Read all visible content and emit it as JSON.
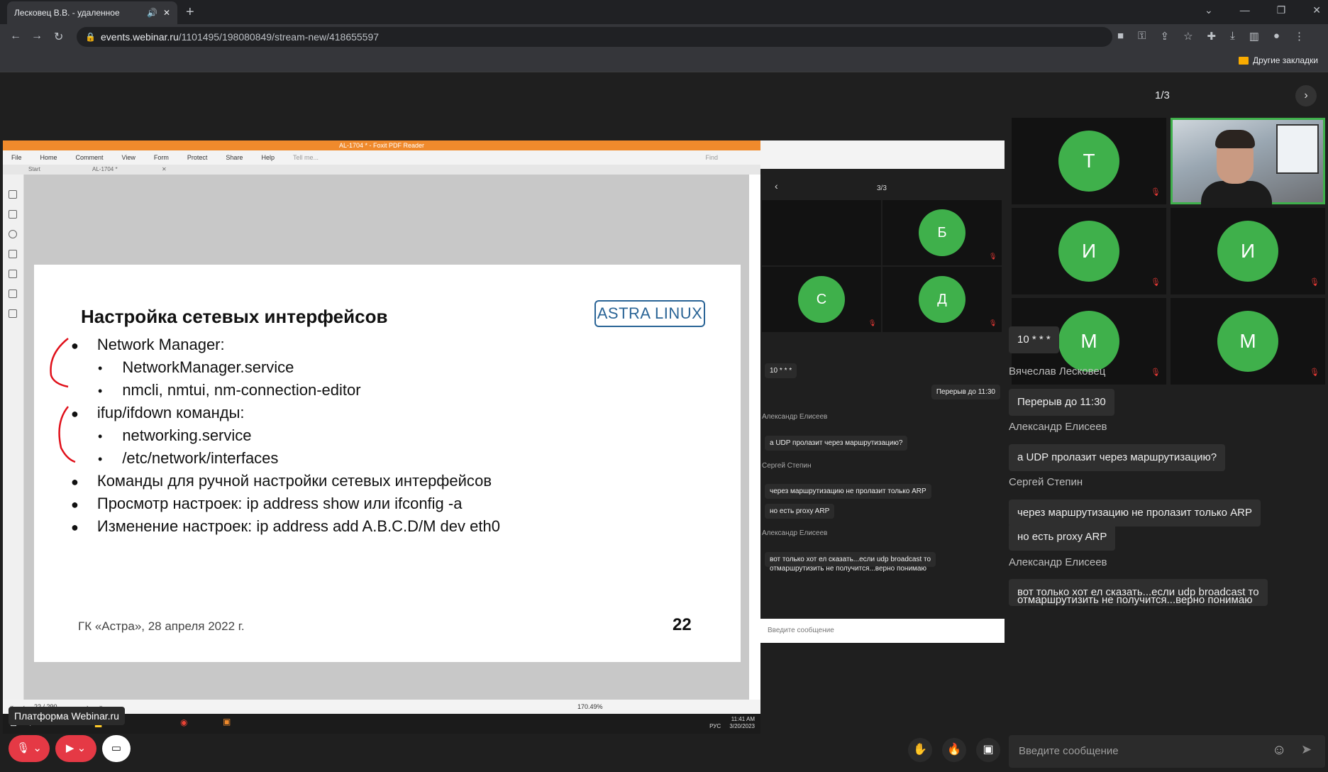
{
  "browser": {
    "tab_title": "Лесковец В.В. - удаленное",
    "url_host": "events.webinar.ru",
    "url_path": "/1101495/198080849/stream-new/418655597",
    "bookmark_folder": "Другие закладки"
  },
  "webinar": {
    "pager": "1/3",
    "platform_label": "Платформа Webinar.ru",
    "chat_placeholder": "Введите сообщение",
    "participants": [
      {
        "initial": "Т",
        "color": "#3fb04b"
      },
      {
        "initial": "И",
        "color": "#3fb04b"
      },
      {
        "initial": "И",
        "color": "#3fb04b"
      },
      {
        "initial": "М",
        "color": "#3fb04b"
      },
      {
        "initial": "М",
        "color": "#3fb04b"
      }
    ],
    "chat": [
      {
        "type": "msg",
        "text": "10 * * *"
      },
      {
        "type": "author",
        "text": "Вячеслав Лесковец"
      },
      {
        "type": "msg",
        "text": "Перерыв до 11:30"
      },
      {
        "type": "author",
        "text": "Александр Елисеев"
      },
      {
        "type": "msg",
        "text": "а UDP пролазит через маршрутизацию?"
      },
      {
        "type": "author",
        "text": "Сергей Степин"
      },
      {
        "type": "msg",
        "text": "через маршрутизацию не пролазит только ARP"
      },
      {
        "type": "msg",
        "text": "но есть proxy ARP"
      },
      {
        "type": "author",
        "text": "Александр Елисеев"
      },
      {
        "type": "msg",
        "text": "вот только хот ел сказать...если udp broadcast то"
      },
      {
        "type": "msg2",
        "text": "отмаршрутизить не получится...верно понимаю"
      }
    ]
  },
  "pdf": {
    "window_title": "AL-1704 * - Foxit PDF Reader",
    "menu": [
      "File",
      "Home",
      "Comment",
      "View",
      "Form",
      "Protect",
      "Share",
      "Help"
    ],
    "tell_me": "Tell me...",
    "find": "Find",
    "tab_start": "Start",
    "tab_doc": "AL-1704 *",
    "page_indicator": "22 / 290",
    "zoom": "170.49%",
    "slide": {
      "title": "Настройка сетевых интерфейсов",
      "logo": "ASTRA LINUX",
      "bullets": [
        {
          "level": 1,
          "text": "Network Manager:"
        },
        {
          "level": 2,
          "text": "NetworkManager.service"
        },
        {
          "level": 2,
          "text": "nmcli, nmtui, nm-connection-editor"
        },
        {
          "level": 1,
          "text": "ifup/ifdown команды:"
        },
        {
          "level": 2,
          "text": "networking.service"
        },
        {
          "level": 2,
          "text": "/etc/network/interfaces"
        },
        {
          "level": 1,
          "text": "Команды для ручной настройки сетевых интерфейсов"
        },
        {
          "level": 1,
          "text": "Просмотр настроек: ip address show или ifconfig -a"
        },
        {
          "level": 1,
          "text": "Изменение настроек: ip address add A.B.C.D/M dev eth0"
        }
      ],
      "footer": "ГК «Астра», 28 апреля 2022 г.",
      "page_number": "22"
    },
    "taskbar_clock": {
      "time": "11:41 AM",
      "date": "3/20/2023",
      "lang": "РУС"
    }
  },
  "nested": {
    "pager": "3/3",
    "participants": [
      {
        "initial": "Б",
        "color": "#3fb04b"
      },
      {
        "initial": "С",
        "color": "#3fb04b"
      },
      {
        "initial": "Д",
        "color": "#3fb04b"
      }
    ],
    "chat": [
      {
        "text": "10 * * *"
      },
      {
        "text": "Перерыв до 11:30"
      },
      {
        "author": "Александр Елисеев"
      },
      {
        "text": "а UDP пролазит через маршрутизацию?"
      },
      {
        "author": "Сергей Степин"
      },
      {
        "text": "через маршрутизацию не пролазит только ARP"
      },
      {
        "text": "но есть proxy ARP"
      },
      {
        "author": "Александр Елисеев"
      },
      {
        "text": "вот только хот ел сказать...если udp broadcast то"
      },
      {
        "text": "отмаршрутизить не получится...верно понимаю"
      }
    ],
    "input_placeholder": "Введите сообщение"
  }
}
